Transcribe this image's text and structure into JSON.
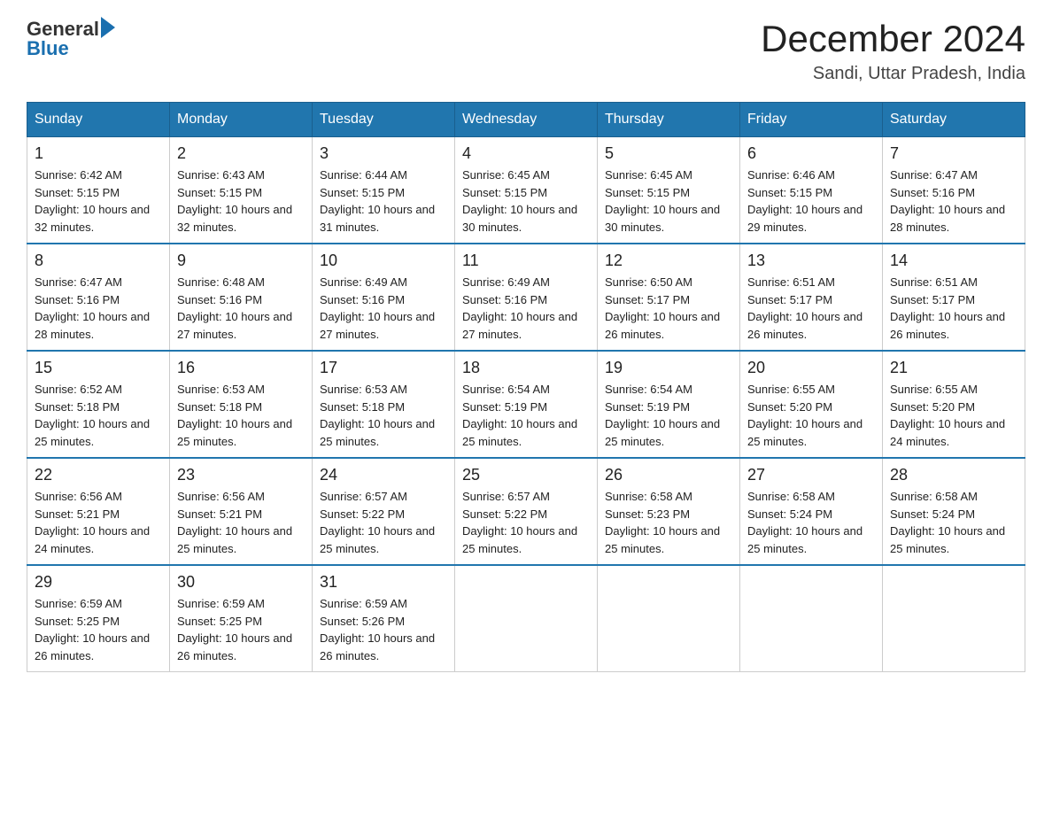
{
  "header": {
    "logo_general": "General",
    "logo_blue": "Blue",
    "title": "December 2024",
    "subtitle": "Sandi, Uttar Pradesh, India"
  },
  "weekdays": [
    "Sunday",
    "Monday",
    "Tuesday",
    "Wednesday",
    "Thursday",
    "Friday",
    "Saturday"
  ],
  "weeks": [
    [
      {
        "day": "1",
        "sunrise": "6:42 AM",
        "sunset": "5:15 PM",
        "daylight": "10 hours and 32 minutes."
      },
      {
        "day": "2",
        "sunrise": "6:43 AM",
        "sunset": "5:15 PM",
        "daylight": "10 hours and 32 minutes."
      },
      {
        "day": "3",
        "sunrise": "6:44 AM",
        "sunset": "5:15 PM",
        "daylight": "10 hours and 31 minutes."
      },
      {
        "day": "4",
        "sunrise": "6:45 AM",
        "sunset": "5:15 PM",
        "daylight": "10 hours and 30 minutes."
      },
      {
        "day": "5",
        "sunrise": "6:45 AM",
        "sunset": "5:15 PM",
        "daylight": "10 hours and 30 minutes."
      },
      {
        "day": "6",
        "sunrise": "6:46 AM",
        "sunset": "5:15 PM",
        "daylight": "10 hours and 29 minutes."
      },
      {
        "day": "7",
        "sunrise": "6:47 AM",
        "sunset": "5:16 PM",
        "daylight": "10 hours and 28 minutes."
      }
    ],
    [
      {
        "day": "8",
        "sunrise": "6:47 AM",
        "sunset": "5:16 PM",
        "daylight": "10 hours and 28 minutes."
      },
      {
        "day": "9",
        "sunrise": "6:48 AM",
        "sunset": "5:16 PM",
        "daylight": "10 hours and 27 minutes."
      },
      {
        "day": "10",
        "sunrise": "6:49 AM",
        "sunset": "5:16 PM",
        "daylight": "10 hours and 27 minutes."
      },
      {
        "day": "11",
        "sunrise": "6:49 AM",
        "sunset": "5:16 PM",
        "daylight": "10 hours and 27 minutes."
      },
      {
        "day": "12",
        "sunrise": "6:50 AM",
        "sunset": "5:17 PM",
        "daylight": "10 hours and 26 minutes."
      },
      {
        "day": "13",
        "sunrise": "6:51 AM",
        "sunset": "5:17 PM",
        "daylight": "10 hours and 26 minutes."
      },
      {
        "day": "14",
        "sunrise": "6:51 AM",
        "sunset": "5:17 PM",
        "daylight": "10 hours and 26 minutes."
      }
    ],
    [
      {
        "day": "15",
        "sunrise": "6:52 AM",
        "sunset": "5:18 PM",
        "daylight": "10 hours and 25 minutes."
      },
      {
        "day": "16",
        "sunrise": "6:53 AM",
        "sunset": "5:18 PM",
        "daylight": "10 hours and 25 minutes."
      },
      {
        "day": "17",
        "sunrise": "6:53 AM",
        "sunset": "5:18 PM",
        "daylight": "10 hours and 25 minutes."
      },
      {
        "day": "18",
        "sunrise": "6:54 AM",
        "sunset": "5:19 PM",
        "daylight": "10 hours and 25 minutes."
      },
      {
        "day": "19",
        "sunrise": "6:54 AM",
        "sunset": "5:19 PM",
        "daylight": "10 hours and 25 minutes."
      },
      {
        "day": "20",
        "sunrise": "6:55 AM",
        "sunset": "5:20 PM",
        "daylight": "10 hours and 25 minutes."
      },
      {
        "day": "21",
        "sunrise": "6:55 AM",
        "sunset": "5:20 PM",
        "daylight": "10 hours and 24 minutes."
      }
    ],
    [
      {
        "day": "22",
        "sunrise": "6:56 AM",
        "sunset": "5:21 PM",
        "daylight": "10 hours and 24 minutes."
      },
      {
        "day": "23",
        "sunrise": "6:56 AM",
        "sunset": "5:21 PM",
        "daylight": "10 hours and 25 minutes."
      },
      {
        "day": "24",
        "sunrise": "6:57 AM",
        "sunset": "5:22 PM",
        "daylight": "10 hours and 25 minutes."
      },
      {
        "day": "25",
        "sunrise": "6:57 AM",
        "sunset": "5:22 PM",
        "daylight": "10 hours and 25 minutes."
      },
      {
        "day": "26",
        "sunrise": "6:58 AM",
        "sunset": "5:23 PM",
        "daylight": "10 hours and 25 minutes."
      },
      {
        "day": "27",
        "sunrise": "6:58 AM",
        "sunset": "5:24 PM",
        "daylight": "10 hours and 25 minutes."
      },
      {
        "day": "28",
        "sunrise": "6:58 AM",
        "sunset": "5:24 PM",
        "daylight": "10 hours and 25 minutes."
      }
    ],
    [
      {
        "day": "29",
        "sunrise": "6:59 AM",
        "sunset": "5:25 PM",
        "daylight": "10 hours and 26 minutes."
      },
      {
        "day": "30",
        "sunrise": "6:59 AM",
        "sunset": "5:25 PM",
        "daylight": "10 hours and 26 minutes."
      },
      {
        "day": "31",
        "sunrise": "6:59 AM",
        "sunset": "5:26 PM",
        "daylight": "10 hours and 26 minutes."
      },
      null,
      null,
      null,
      null
    ]
  ]
}
